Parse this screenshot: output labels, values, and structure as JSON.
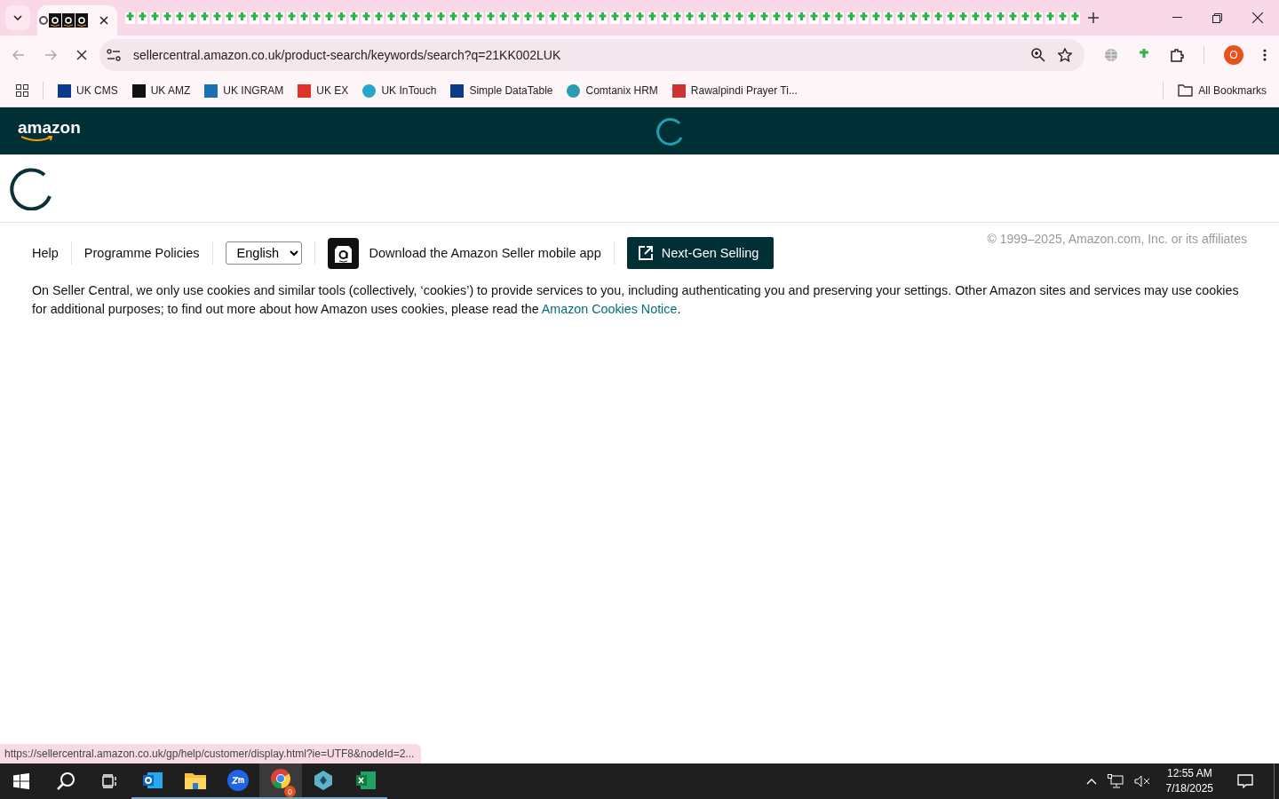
{
  "browser": {
    "address": "sellercentral.amazon.co.uk/product-search/keywords/search?q=21KK002LUK",
    "profile_initial": "O",
    "loading": true,
    "bookmarks": [
      {
        "label": "UK CMS",
        "kind": "df"
      },
      {
        "label": "UK AMZ",
        "kind": "amz"
      },
      {
        "label": "UK INGRAM",
        "kind": "ingram"
      },
      {
        "label": "UK EX",
        "kind": "ex"
      },
      {
        "label": "UK InTouch",
        "kind": "intouch"
      },
      {
        "label": "Simple DataTable",
        "kind": "df"
      },
      {
        "label": "Comtanix HRM",
        "kind": "hrm"
      },
      {
        "label": "Rawalpindi Prayer Ti...",
        "kind": "prayer"
      }
    ],
    "all_bookmarks": "All Bookmarks"
  },
  "header": {
    "logo": "amazon"
  },
  "footer": {
    "links": [
      "Help",
      "Programme Policies"
    ],
    "language": "English",
    "app_link": "Download the Amazon Seller mobile app",
    "next_gen_button": "Next-Gen Selling",
    "copyright": "© 1999–2025, Amazon.com, Inc. or its affiliates",
    "cookie_text": "On Seller Central, we only use cookies and similar tools (collectively, ‘cookies’) to provide services to you, including authenticating you and preserving your settings. Other Amazon sites and services may use cookies for additional purposes; to find out more about how Amazon uses cookies, please read the ",
    "cookie_link": "Amazon Cookies Notice",
    "cookie_end": "."
  },
  "status_url": "https://sellercentral.amazon.co.uk/gp/help/customer/display.html?ie=UTF8&nodeId=2...",
  "taskbar": {
    "time": "12:55 AM",
    "date": "7/18/2025",
    "chrome_badge": "0",
    "apps": [
      {
        "kind": "outlook",
        "selected": false
      },
      {
        "kind": "files",
        "selected": false
      },
      {
        "kind": "zoom",
        "selected": false
      },
      {
        "kind": "chrome",
        "selected": true
      },
      {
        "kind": "diamond",
        "selected": false
      },
      {
        "kind": "excel",
        "selected": false
      }
    ]
  }
}
